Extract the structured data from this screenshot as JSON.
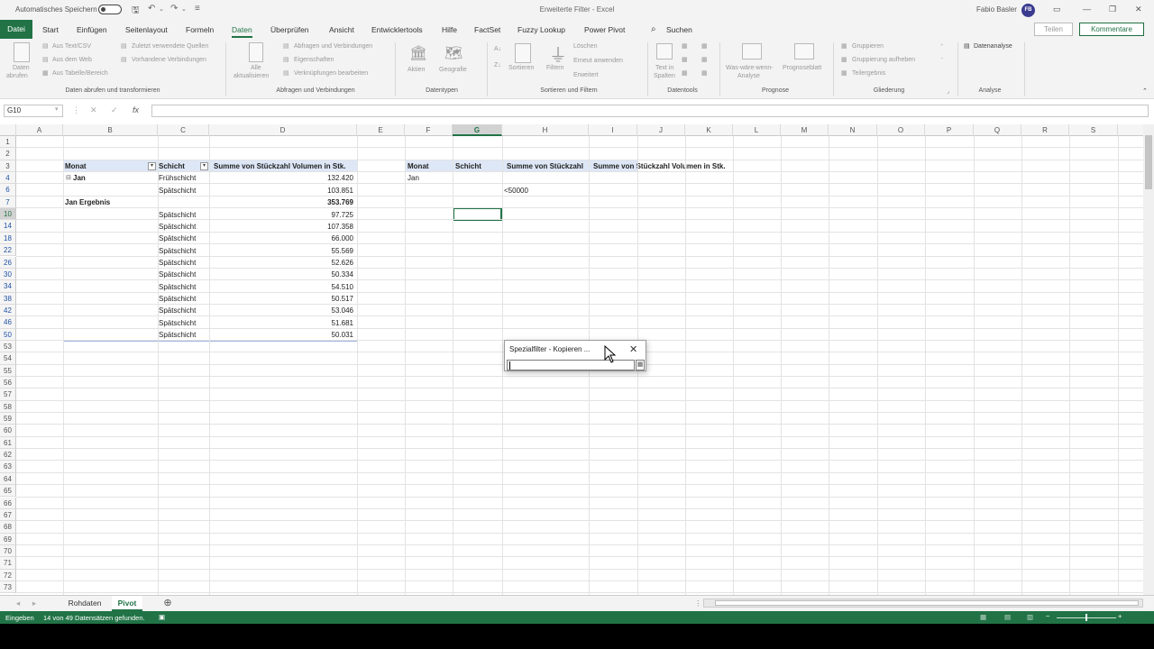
{
  "titlebar": {
    "autosave_label": "Automatisches Speichern",
    "doc_title": "Erweiterte Filter  -  Excel",
    "user_name": "Fabio Basler",
    "user_initials": "FB"
  },
  "menu": {
    "file": "Datei",
    "items": [
      "Start",
      "Einfügen",
      "Seitenlayout",
      "Formeln",
      "Daten",
      "Überprüfen",
      "Ansicht",
      "Entwicklertools",
      "Hilfe",
      "FactSet",
      "Fuzzy Lookup",
      "Power Pivot",
      "Suchen"
    ],
    "active": "Daten",
    "share": "Teilen",
    "comments": "Kommentare"
  },
  "ribbon": {
    "groups": {
      "get_data": "Daten abrufen und transformieren",
      "queries": "Abfragen und Verbindungen",
      "datatypes": "Datentypen",
      "sort_filter": "Sortieren und Filtern",
      "datatools": "Datentools",
      "forecast": "Prognose",
      "outline": "Gliederung",
      "analysis": "Analyse"
    },
    "get_data_btn": [
      "Daten",
      "abrufen"
    ],
    "get_data_items": [
      "Aus Text/CSV",
      "Aus dem Web",
      "Aus Tabelle/Bereich"
    ],
    "recent_items": [
      "Zuletzt verwendete Quellen",
      "Vorhandene Verbindungen"
    ],
    "refresh_btn": [
      "Alle",
      "aktualisieren"
    ],
    "query_items": [
      "Abfragen und Verbindungen",
      "Eigenschaften",
      "Verknüpfungen bearbeiten"
    ],
    "datatypes": [
      "Aktien",
      "Geografie"
    ],
    "sort": "Sortieren",
    "filter": "Filtern",
    "filter_items": [
      "Löschen",
      "Erneut anwenden",
      "Erweitert"
    ],
    "text_to_cols": [
      "Text in",
      "Spalten"
    ],
    "whatif": [
      "Was-wäre-wenn-",
      "Analyse"
    ],
    "forecast_sheet": "Prognoseblatt",
    "outline_items": [
      "Gruppieren",
      "Gruppierung aufheben",
      "Teilergebnis"
    ],
    "analysis_btn": "Datenanalyse"
  },
  "formula_bar": {
    "name_box": "G10",
    "formula": ""
  },
  "columns": [
    "A",
    "B",
    "C",
    "D",
    "E",
    "F",
    "G",
    "H",
    "I",
    "J",
    "K",
    "L",
    "M",
    "N",
    "O",
    "P",
    "Q",
    "R",
    "S"
  ],
  "selected_column": "G",
  "rows": [
    "1",
    "2",
    "3",
    "4",
    "6",
    "7",
    "10",
    "14",
    "18",
    "22",
    "26",
    "30",
    "34",
    "38",
    "42",
    "46",
    "50",
    "53",
    "54",
    "55",
    "56",
    "57",
    "58",
    "59",
    "60",
    "61",
    "62",
    "63",
    "64",
    "65",
    "66",
    "67",
    "68",
    "69",
    "70",
    "71",
    "72",
    "73"
  ],
  "pivot": {
    "headers": [
      "Monat",
      "Schicht",
      "Summe von Stückzahl Volumen in Stk."
    ],
    "month": "Jan",
    "month_rows": [
      {
        "shift": "Frühschicht",
        "value": "132.420"
      },
      {
        "shift": "Spätschicht",
        "value": "103.851"
      }
    ],
    "subtotal_label": "Jan Ergebnis",
    "subtotal_value": "353.769",
    "detail_rows": [
      {
        "shift": "Spätschicht",
        "value": "97.725"
      },
      {
        "shift": "Spätschicht",
        "value": "107.358"
      },
      {
        "shift": "Spätschicht",
        "value": "66.000"
      },
      {
        "shift": "Spätschicht",
        "value": "55.569"
      },
      {
        "shift": "Spätschicht",
        "value": "52.626"
      },
      {
        "shift": "Spätschicht",
        "value": "50.334"
      },
      {
        "shift": "Spätschicht",
        "value": "54.510"
      },
      {
        "shift": "Spätschicht",
        "value": "50.517"
      },
      {
        "shift": "Spätschicht",
        "value": "53.046"
      },
      {
        "shift": "Spätschicht",
        "value": "51.681"
      },
      {
        "shift": "Spätschicht",
        "value": "50.031"
      }
    ]
  },
  "criteria": {
    "headers": [
      "Monat",
      "Schicht",
      "Summe von Stückzahl",
      "Summe von Stückzahl Volumen in Stk."
    ],
    "month": "Jan",
    "value_criterion": "<50000"
  },
  "dialog": {
    "title": "Spezialfilter - Kopieren ...",
    "input_value": ""
  },
  "sheets": [
    "Rohdaten",
    "Pivot"
  ],
  "active_sheet": "Pivot",
  "status": {
    "mode": "Eingeben",
    "message": "14 von 49 Datensätzen gefunden."
  }
}
